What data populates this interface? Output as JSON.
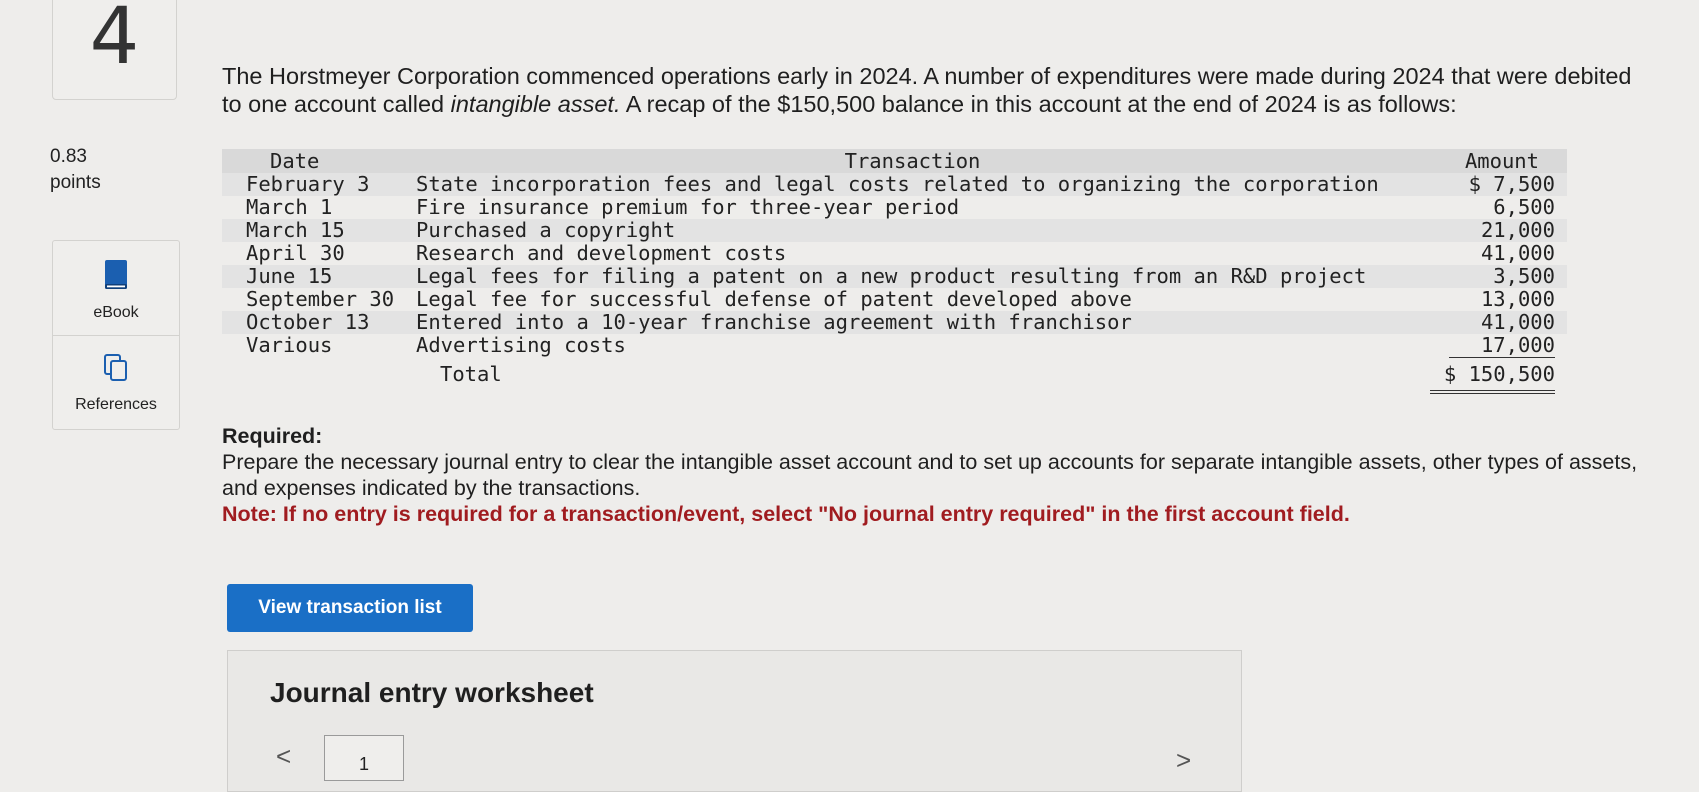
{
  "question": {
    "number": "4",
    "points_value": "0.83",
    "points_label": "points"
  },
  "sidebar": {
    "ebook_label": "eBook",
    "references_label": "References",
    "ebook_icon": "book-icon",
    "references_icon": "copy-pages-icon"
  },
  "intro": {
    "part1": "The Horstmeyer Corporation commenced operations early in 2024. A number of expenditures were made during 2024 that were debited to one account called ",
    "emph": "intangible asset.",
    "part2": " A recap of the $150,500 balance in this account at the end of 2024 is as follows:"
  },
  "recap_table": {
    "headers": {
      "date": "Date",
      "transaction": "Transaction",
      "amount": "Amount"
    },
    "rows": [
      {
        "date": "February 3",
        "transaction": "State incorporation fees and legal costs related to organizing the corporation",
        "amount": "$ 7,500"
      },
      {
        "date": "March 1",
        "transaction": "Fire insurance premium for three-year period",
        "amount": "6,500"
      },
      {
        "date": "March 15",
        "transaction": "Purchased a copyright",
        "amount": "21,000"
      },
      {
        "date": "April 30",
        "transaction": "Research and development costs",
        "amount": "41,000"
      },
      {
        "date": "June 15",
        "transaction": "Legal fees for filing a patent on a new product resulting from an R&D project",
        "amount": "3,500"
      },
      {
        "date": "September 30",
        "transaction": "Legal fee for successful defense of patent developed above",
        "amount": "13,000"
      },
      {
        "date": "October 13",
        "transaction": "Entered into a 10-year franchise agreement with franchisor",
        "amount": "41,000"
      },
      {
        "date": "Various",
        "transaction": "Advertising costs",
        "amount": "17,000"
      }
    ],
    "total_label": "Total",
    "total_amount": "$ 150,500"
  },
  "required": {
    "heading": "Required:",
    "text": "Prepare the necessary journal entry to clear the intangible asset account and to set up accounts for separate intangible assets, other types of assets, and expenses indicated by the transactions.",
    "note": "Note: If no entry is required for a transaction/event, select \"No journal entry required\" in the first account field."
  },
  "actions": {
    "view_transactions_label": "View transaction list"
  },
  "worksheet": {
    "title": "Journal entry worksheet",
    "page": "1",
    "prev_symbol": "<",
    "next_symbol": ">"
  },
  "colors": {
    "button_blue": "#1a6fc6",
    "note_red": "#a01c20",
    "table_header_gray": "#d9d9d9",
    "row_stripe_gray": "#e3e3e3"
  }
}
